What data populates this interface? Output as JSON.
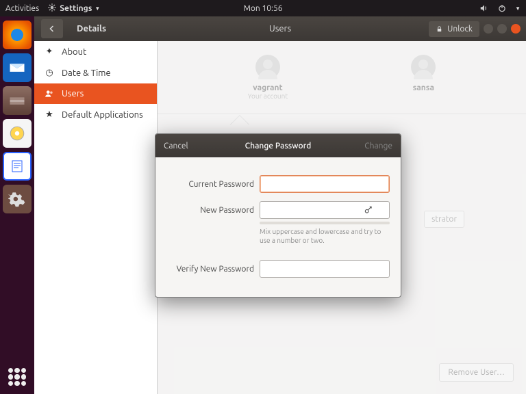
{
  "topbar": {
    "activities": "Activities",
    "app_name": "Settings",
    "clock": "Mon 10:56"
  },
  "window": {
    "back_label": "‹",
    "details_title": "Details",
    "center_title": "Users",
    "unlock_label": "Unlock"
  },
  "sidebar": {
    "about": "About",
    "date_time": "Date & Time",
    "users": "Users",
    "default_apps": "Default Applications"
  },
  "users": {
    "u1_name": "vagrant",
    "u1_sub": "Your account",
    "u2_name": "sansa",
    "admin_chip": "strator",
    "remove_user": "Remove User…"
  },
  "dialog": {
    "title": "Change Password",
    "cancel": "Cancel",
    "change": "Change",
    "current_label": "Current Password",
    "new_label": "New Password",
    "verify_label": "Verify New Password",
    "hint": "Mix uppercase and lowercase and try to use a number or two."
  }
}
